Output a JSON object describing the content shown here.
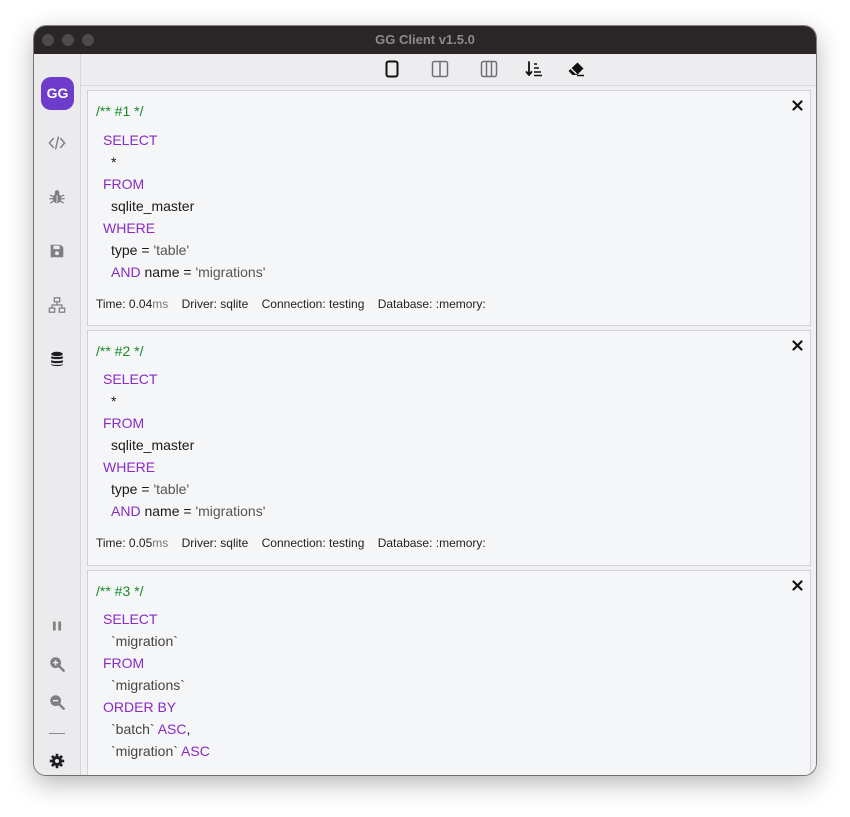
{
  "window": {
    "title": "GG Client v1.5.0"
  },
  "sidebar": {
    "logo": "GG",
    "icons": [
      "code-icon",
      "bug-icon",
      "save-icon",
      "network-icon",
      "database-icon",
      "pause-icon",
      "zoom-in-icon",
      "zoom-out-icon",
      "gear-icon"
    ]
  },
  "toolbar": {
    "icons": [
      "single-column-icon",
      "two-column-icon",
      "three-column-icon",
      "sort-descending-icon",
      "eraser-icon"
    ]
  },
  "colors": {
    "accent": "#6d3ccb",
    "keyword": "#8a2bc4",
    "comment": "#1a8a2a"
  },
  "queries": [
    {
      "comment": "/** #1 */",
      "kw_select": "SELECT",
      "select_expr": "*",
      "kw_from": "FROM",
      "table": "sqlite_master",
      "kw_where": "WHERE",
      "cond1_col": "type",
      "cond1_op": "=",
      "cond1_val": "'table'",
      "kw_and": "AND",
      "cond2_col": "name",
      "cond2_op": "=",
      "cond2_val": "'migrations'",
      "meta": {
        "time_label": "Time:",
        "time_value": "0.04",
        "time_unit": "ms",
        "driver": "Driver: sqlite",
        "connection": "Connection: testing",
        "database": "Database: :memory:"
      }
    },
    {
      "comment": "/** #2 */",
      "kw_select": "SELECT",
      "select_expr": "*",
      "kw_from": "FROM",
      "table": "sqlite_master",
      "kw_where": "WHERE",
      "cond1_col": "type",
      "cond1_op": "=",
      "cond1_val": "'table'",
      "kw_and": "AND",
      "cond2_col": "name",
      "cond2_op": "=",
      "cond2_val": "'migrations'",
      "meta": {
        "time_label": "Time:",
        "time_value": "0.05",
        "time_unit": "ms",
        "driver": "Driver: sqlite",
        "connection": "Connection: testing",
        "database": "Database: :memory:"
      }
    },
    {
      "comment": "/** #3 */",
      "kw_select": "SELECT",
      "select_expr": "`migration`",
      "kw_from": "FROM",
      "table": "`migrations`",
      "kw_order": "ORDER BY",
      "order1_col": "`batch`",
      "order1_dir": "ASC",
      "order1_sep": ",",
      "order2_col": "`migration`",
      "order2_dir": "ASC"
    }
  ]
}
